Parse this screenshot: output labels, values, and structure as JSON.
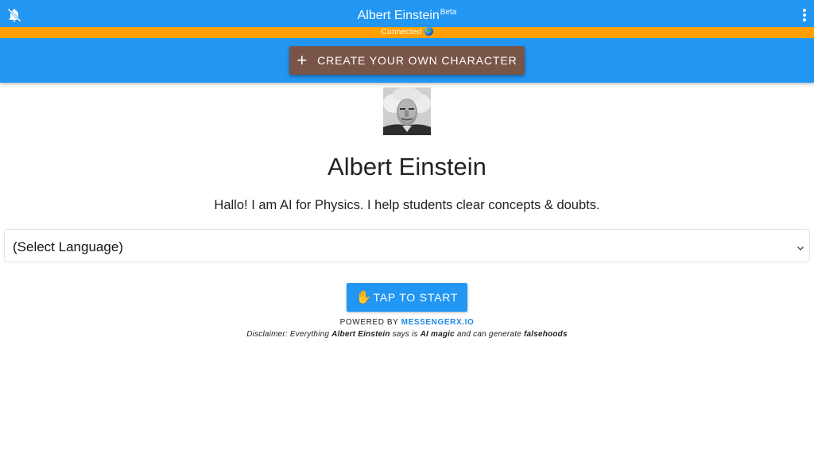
{
  "header": {
    "title": "Albert Einstein",
    "title_sup": "Beta",
    "mute_icon": "bell-off-icon",
    "menu_icon": "more-vert-icon",
    "color": "#2196f3"
  },
  "status": {
    "text": "Connected",
    "icon": "globe-icon",
    "color": "#ffa000"
  },
  "create_button": {
    "icon": "plus-icon",
    "label": "CREATE YOUR OWN CHARACTER",
    "color": "#795548"
  },
  "profile": {
    "avatar_icon": "portrait",
    "name": "Albert Einstein",
    "tagline": "Hallo! I am AI for Physics. I help students clear concepts & doubts."
  },
  "language_select": {
    "selected": "(Select Language)",
    "icon": "chevron-down-icon"
  },
  "start_button": {
    "icon": "waving-hand-icon",
    "icon_glyph": "✋",
    "label": "TAP TO START",
    "color": "#2196f3"
  },
  "footer": {
    "powered_prefix": "POWERED BY",
    "powered_link": "MESSENGERX.IO",
    "disclaimer": {
      "part1": "Disclaimer: Everything",
      "name": "Albert Einstein",
      "part2": "says is",
      "magic": "AI magic",
      "part3": "and can generate",
      "falsehoods": "falsehoods"
    }
  }
}
